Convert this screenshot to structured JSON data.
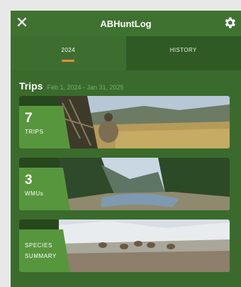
{
  "header": {
    "title": "ABHuntLog",
    "close_icon": "close-icon",
    "settings_icon": "gear-icon"
  },
  "tabs": [
    {
      "label": "2024",
      "active": true
    },
    {
      "label": "HISTORY",
      "active": false
    }
  ],
  "trips": {
    "heading": "Trips",
    "date_range": "Feb 1, 2024 - Jan 31, 2025"
  },
  "cards": [
    {
      "number": "7",
      "caption": "TRIPS"
    },
    {
      "number": "3",
      "caption": "WMUs"
    },
    {
      "caption_line1": "SPECIES",
      "caption_line2": "SUMMARY"
    }
  ],
  "colors": {
    "accent": "#f08a3a",
    "primary": "#3a6b2c",
    "label_bg": "#58963d"
  }
}
